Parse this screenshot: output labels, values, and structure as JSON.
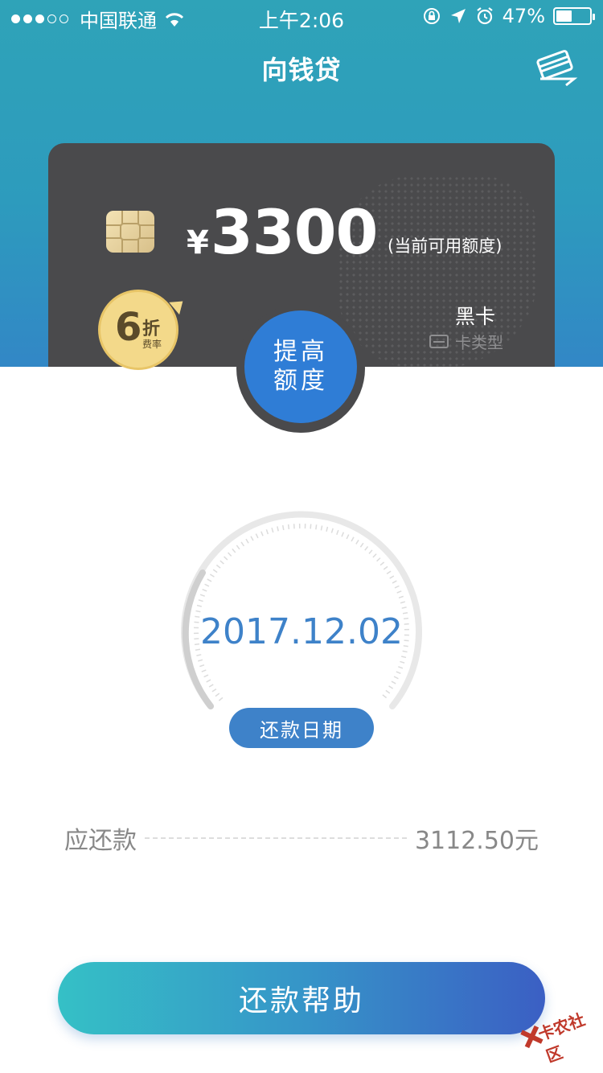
{
  "status_bar": {
    "carrier": "中国联通",
    "time": "上午2:06",
    "battery": "47%",
    "battery_level": 0.47
  },
  "nav": {
    "title": "向钱贷"
  },
  "card": {
    "currency": "¥",
    "amount": "3300",
    "amount_label": "(当前可用额度)",
    "card_type": "黑卡",
    "card_type_label": "卡类型"
  },
  "badge": {
    "number": "6",
    "unit": "折",
    "subtitle": "费率"
  },
  "boost_button": {
    "line1": "提高",
    "line2": "额度"
  },
  "repayment": {
    "date": "2017.12.02",
    "date_label": "还款日期",
    "due_label": "应还款",
    "due_value": "3112.50元"
  },
  "help_button": {
    "label": "还款帮助"
  },
  "watermark": {
    "text": "卡农社区"
  },
  "colors": {
    "header_top": "#2fa3b8",
    "header_bottom": "#3287c6",
    "card": "#4a4a4c",
    "accent_blue": "#3e82c9",
    "boost_blue": "#2f7dd6"
  }
}
